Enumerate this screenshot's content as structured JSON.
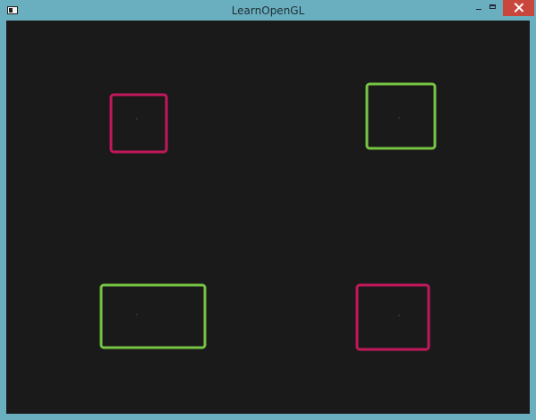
{
  "window": {
    "title": "LearnOpenGL",
    "icons": {
      "app": "window-app-icon",
      "minimize": "minimize-icon",
      "maximize": "maximize-icon",
      "close": "close-icon"
    },
    "colors": {
      "frame": "#6aafc0",
      "close_button": "#c9463d",
      "viewport_background": "#1a1a1a"
    }
  },
  "scene": {
    "shape_type": "rounded-rectangle-outline",
    "colors": {
      "magenta": "#c2185b",
      "green": "#76c442",
      "center_marker": "#5d6660"
    },
    "objects": [
      {
        "name": "top-left-magenta-rectangle",
        "color_key": "magenta",
        "has_center_marker": true
      },
      {
        "name": "top-right-green-rectangle",
        "color_key": "green",
        "has_center_marker": true
      },
      {
        "name": "bottom-left-green-rectangle",
        "color_key": "green",
        "has_center_marker": true
      },
      {
        "name": "bottom-right-magenta-rectangle",
        "color_key": "magenta",
        "has_center_marker": true
      }
    ]
  }
}
